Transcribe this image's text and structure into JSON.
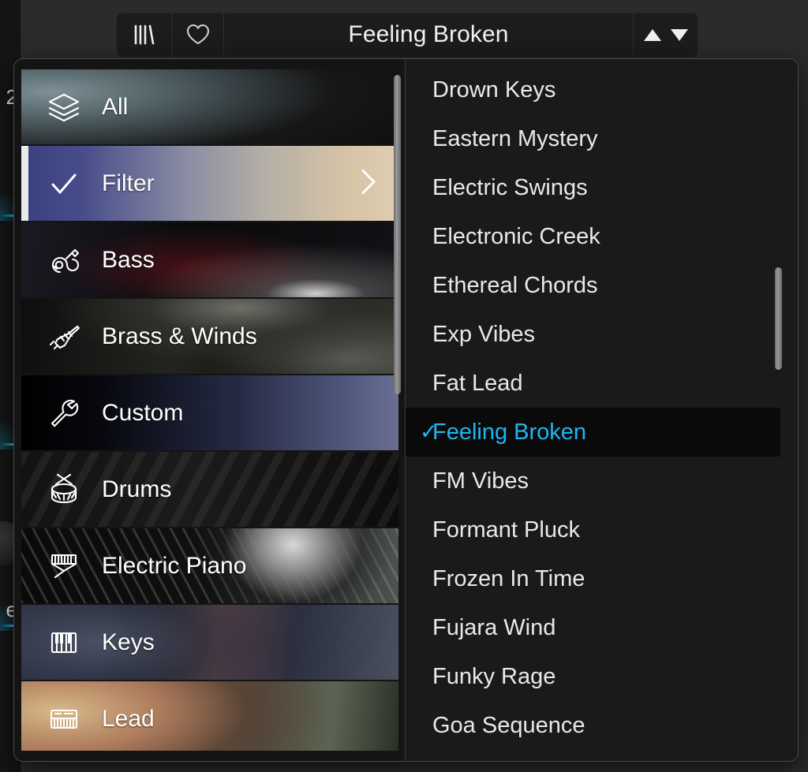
{
  "app": {
    "background_color": "#2b2b2b",
    "accent_color": "#1fb6f0",
    "panel_color": "#1a1a1a"
  },
  "background": {
    "partial_glyph_top": "2",
    "partial_glyph_bottom": "e"
  },
  "topbar": {
    "library_icon": "library-icon",
    "favorite_icon": "heart-icon",
    "preset_name": "Feeling Broken",
    "prev_icon": "triangle-up-icon",
    "next_icon": "triangle-down-icon"
  },
  "categories": {
    "scrollbar": "category-scrollbar",
    "items": [
      {
        "label": "All",
        "icon": "layers-icon",
        "thumb": "th-all",
        "state": "normal",
        "chevron": false
      },
      {
        "label": "Filter",
        "icon": "checkmark-icon",
        "thumb": "th-filter",
        "state": "selected",
        "chevron": true
      },
      {
        "label": "Bass",
        "icon": "guitar-icon",
        "thumb": "th-bass",
        "state": "normal",
        "chevron": false
      },
      {
        "label": "Brass & Winds",
        "icon": "trumpet-icon",
        "thumb": "th-brass",
        "state": "normal",
        "chevron": false
      },
      {
        "label": "Custom",
        "icon": "wrench-icon",
        "thumb": "th-custom",
        "state": "hover",
        "chevron": false
      },
      {
        "label": "Drums",
        "icon": "snare-drum-icon",
        "thumb": "th-drums",
        "state": "normal",
        "chevron": false
      },
      {
        "label": "Electric Piano",
        "icon": "electric-piano-icon",
        "thumb": "th-epiano",
        "state": "normal",
        "chevron": false
      },
      {
        "label": "Keys",
        "icon": "piano-keys-icon",
        "thumb": "th-keys",
        "state": "normal",
        "chevron": false
      },
      {
        "label": "Lead",
        "icon": "synth-icon",
        "thumb": "th-lead",
        "state": "normal",
        "chevron": false
      }
    ]
  },
  "presets": {
    "scrollbar": "preset-scrollbar",
    "selected": "Feeling Broken",
    "check_icon": "checkmark-icon",
    "items": [
      {
        "label": "Drown Keys",
        "selected": false
      },
      {
        "label": "Eastern Mystery",
        "selected": false
      },
      {
        "label": "Electric Swings",
        "selected": false
      },
      {
        "label": "Electronic Creek",
        "selected": false
      },
      {
        "label": "Ethereal Chords",
        "selected": false
      },
      {
        "label": "Exp Vibes",
        "selected": false
      },
      {
        "label": "Fat Lead",
        "selected": false
      },
      {
        "label": "Feeling Broken",
        "selected": true
      },
      {
        "label": "FM Vibes",
        "selected": false
      },
      {
        "label": "Formant Pluck",
        "selected": false
      },
      {
        "label": "Frozen In Time",
        "selected": false
      },
      {
        "label": "Fujara Wind",
        "selected": false
      },
      {
        "label": "Funky Rage",
        "selected": false
      },
      {
        "label": "Goa Sequence",
        "selected": false
      }
    ]
  }
}
